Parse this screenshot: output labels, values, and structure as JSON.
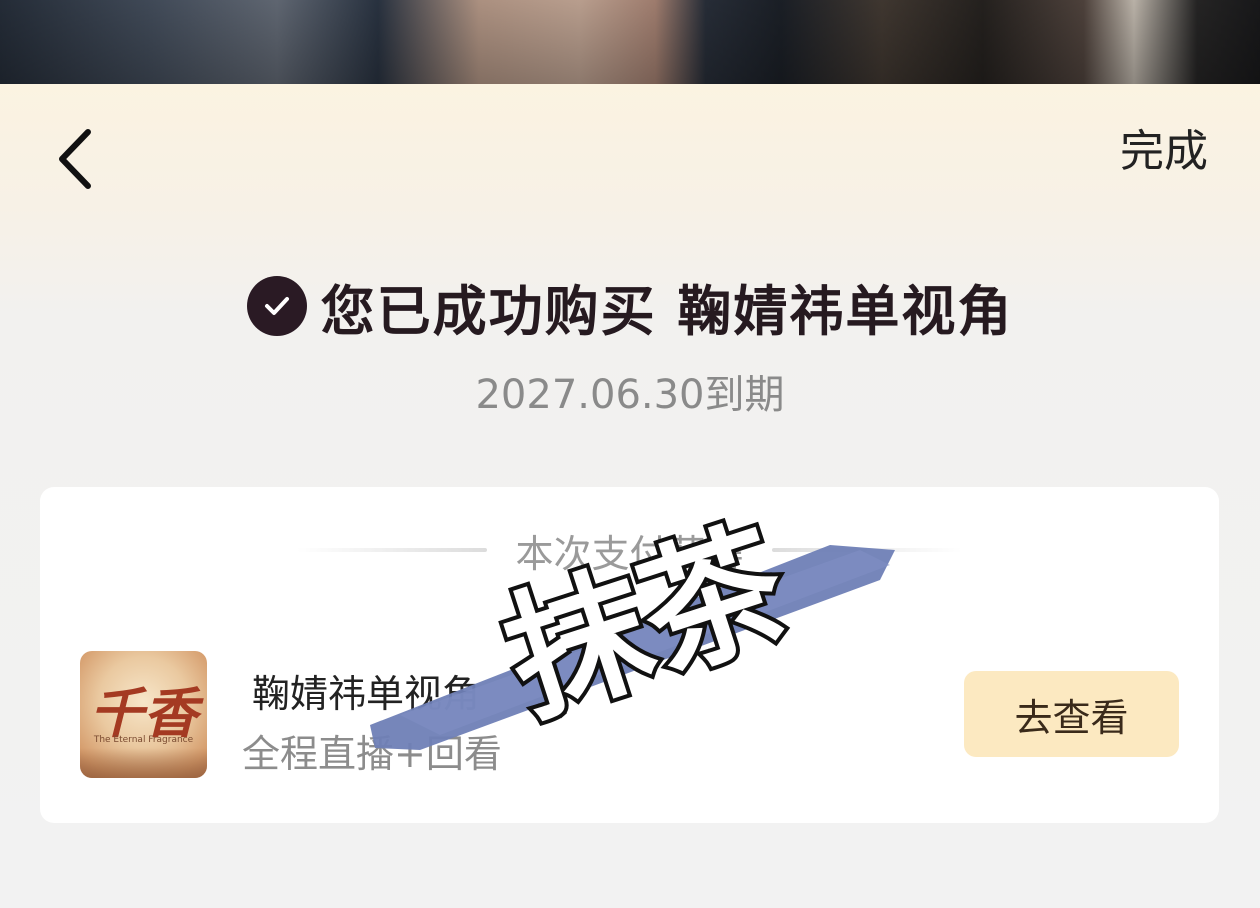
{
  "header": {
    "done_label": "完成"
  },
  "status": {
    "title": "您已成功购买 鞠婧祎单视角",
    "expire": "2027.06.30到期"
  },
  "card": {
    "section_label": "本次支付获得",
    "item": {
      "title": "鞠婧祎单视角",
      "subtitle": "全程直播+回看",
      "button_label": "去查看",
      "thumbnail_title": "千香",
      "thumbnail_subtitle": "The Eternal Fragrance"
    }
  },
  "watermark": {
    "text": "抹茶"
  },
  "colors": {
    "accent_button_bg": "#fce9c1",
    "check_badge": "#2a1a24",
    "watermark_stroke": "#6f7fb6"
  },
  "icons": {
    "back": "chevron-left-icon",
    "check": "check-circle-icon"
  }
}
